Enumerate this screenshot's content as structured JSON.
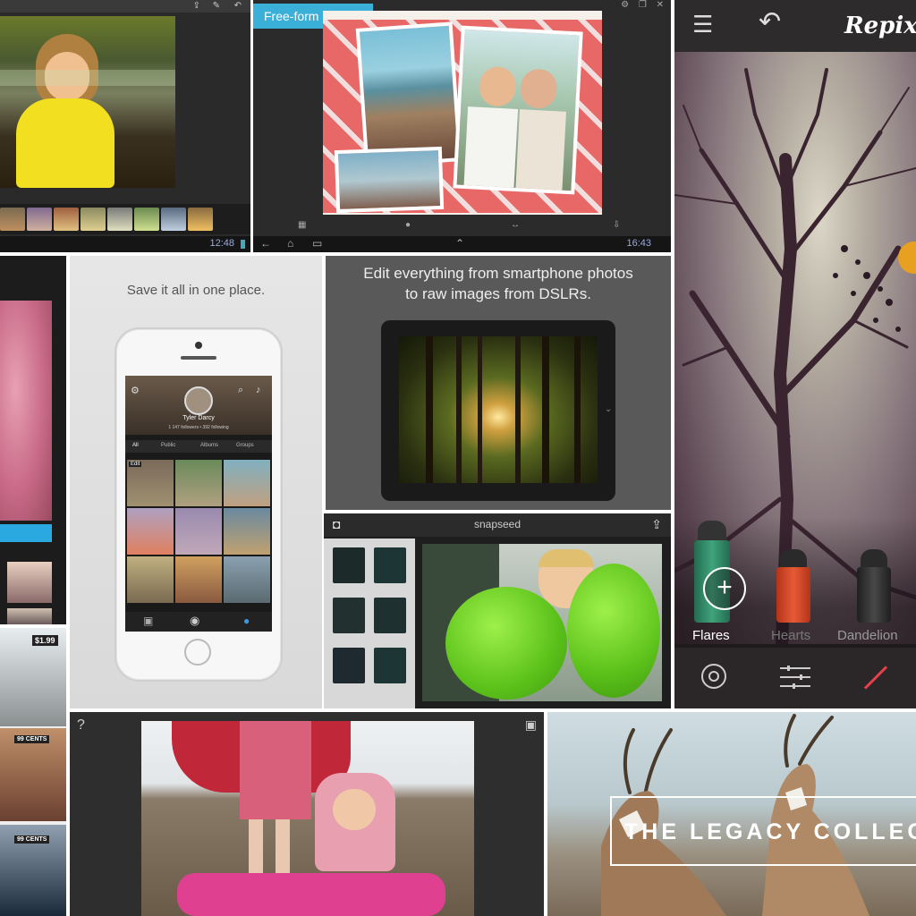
{
  "collage_panel": {
    "badge": "Free-form collage",
    "clock": "16:43"
  },
  "android_editor": {
    "clock": "12:48"
  },
  "repix": {
    "app_title": "Repix",
    "brushes": [
      {
        "label": "Flares",
        "color": "#2f8f6a"
      },
      {
        "label": "Hearts",
        "color": "#e04a2a"
      },
      {
        "label": "Dandelion",
        "color": "#333"
      }
    ]
  },
  "flickr": {
    "caption": "Save it all in one place.",
    "profile_name": "Tyler Darcy",
    "profile_meta": "1 147 followers • 392 following",
    "tabs": [
      "All",
      "Public",
      "Albums",
      "Groups"
    ],
    "edit_label": "Edit"
  },
  "lightroom": {
    "caption_line1": "Edit everything from smartphone photos",
    "caption_line2": "to raw images from DSLRs."
  },
  "snapseed": {
    "title": "snapseed"
  },
  "prints": {
    "price_1": "$1.99",
    "price_2": "99 CENTS",
    "price_3": "99 CENTS"
  },
  "instapaper_like": {
    "help": "?"
  },
  "legacy": {
    "title": "THE LEGACY COLLEC"
  }
}
